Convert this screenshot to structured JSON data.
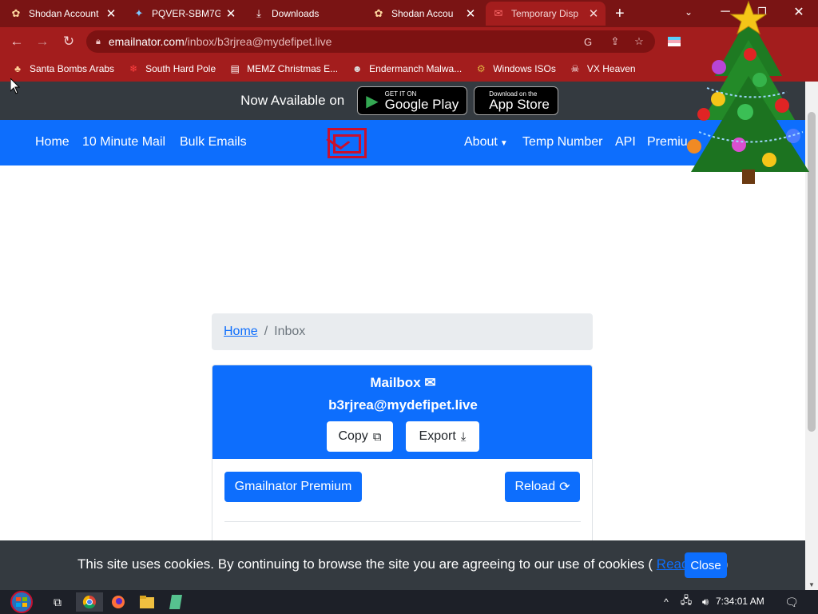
{
  "browser": {
    "tabs": [
      {
        "title": "Shodan Account",
        "icon": "christmas-icon"
      },
      {
        "title": "PQVER-SBM7G",
        "icon": "twitter-icon"
      },
      {
        "title": "Downloads",
        "icon": "download-icon"
      },
      {
        "title": "Shodan Accou",
        "icon": "christmas-icon"
      },
      {
        "title": "Temporary Disp",
        "icon": "email-icon"
      }
    ],
    "url_host": "emailnator.com",
    "url_path": "/inbox/b3rjrea@mydefipet.live",
    "bookmarks": [
      {
        "label": "Santa Bombs Arabs",
        "icon": "bomb-icon"
      },
      {
        "label": "South Hard Pole",
        "icon": "snowflake-icon"
      },
      {
        "label": "MEMZ Christmas E...",
        "icon": "file-icon"
      },
      {
        "label": "Endermanch Malwa...",
        "icon": "enderman-icon"
      },
      {
        "label": "Windows ISOs",
        "icon": "gear-icon"
      },
      {
        "label": "VX Heaven",
        "icon": "skull-icon"
      }
    ]
  },
  "banner": {
    "label": "Now Available on",
    "google_small": "GET IT ON",
    "google_big": "Google Play",
    "apple_small": "Download on the",
    "apple_big": "App Store"
  },
  "nav": {
    "home": "Home",
    "ten_minute": "10 Minute Mail",
    "bulk": "Bulk Emails",
    "about": "About",
    "temp_number": "Temp Number",
    "api": "API",
    "premium": "Premiu"
  },
  "breadcrumb": {
    "home": "Home",
    "separator": "/",
    "current": "Inbox"
  },
  "mailbox": {
    "title": "Mailbox",
    "email": "b3rjrea@mydefipet.live",
    "copy_label": "Copy",
    "export_label": "Export",
    "premium_label": "Gmailnator Premium",
    "reload_label": "Reload"
  },
  "cookie": {
    "text": "This site uses cookies. By continuing to browse the site you are agreeing to our use of cookies (",
    "link": "Read more",
    "after": ")",
    "close": "Close"
  },
  "taskbar": {
    "time": "7:34:01 AM"
  },
  "colors": {
    "primary": "#0d6efd",
    "dark": "#343a40",
    "chrome": "#a31d1d",
    "logo": "#c8102e"
  }
}
